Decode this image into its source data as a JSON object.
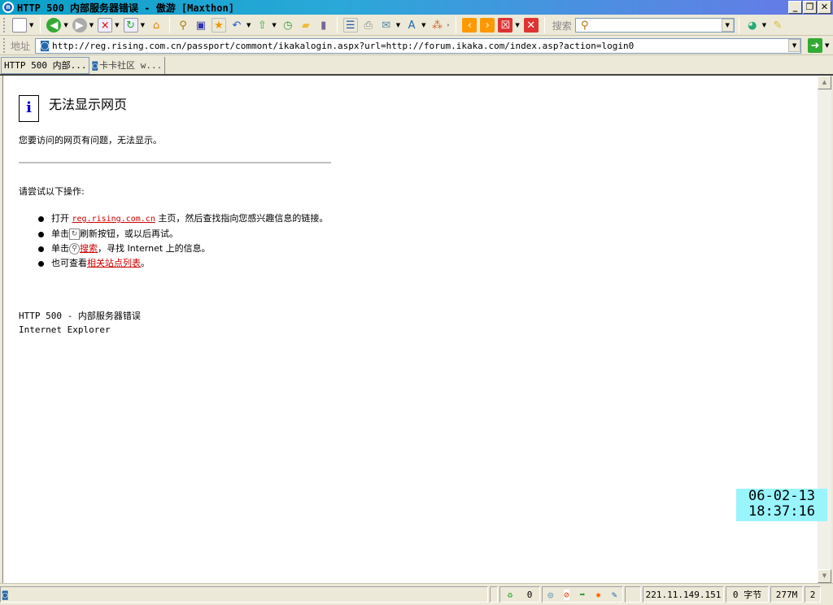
{
  "window": {
    "title": "HTTP 500 内部服务器错误 - 傲游 [Maxthon]",
    "logo": "m",
    "minimize": "_",
    "restore": "❐",
    "close": "✕"
  },
  "toolbar": {
    "search_label": "搜索",
    "search_value": ""
  },
  "address": {
    "label": "地址",
    "url": "http://reg.rising.com.cn/passport/commont/ikakalogin.aspx?url=http://forum.ikaka.com/index.asp?action=login0"
  },
  "tabs": [
    {
      "label": "HTTP 500 内部...",
      "active": true
    },
    {
      "label": "卡卡社区 w...",
      "active": false
    }
  ],
  "page": {
    "info_glyph": "i",
    "heading": "无法显示网页",
    "message": "您要访问的网页有问题，无法显示。",
    "try_label": "请尝试以下操作:",
    "items": [
      {
        "pre": "打开 ",
        "link": "reg.rising.com.cn",
        "post": " 主页，然后查找指向您感兴趣信息的链接。"
      },
      {
        "pre": "单击",
        "post": "刷新按钮，或以后再试。"
      },
      {
        "pre": "单击",
        "link": "搜索",
        "post": "，寻找 Internet 上的信息。"
      },
      {
        "pre": "也可查看",
        "link": "相关站点列表",
        "post": "。"
      }
    ],
    "error_line": "HTTP 500 - 内部服务器错误",
    "browser_line": "Internet Explorer"
  },
  "clock": {
    "date": "06-02-13",
    "time": "18:37:16"
  },
  "status": {
    "count": "0",
    "ip": "221.11.149.151",
    "bytes": "0 字节",
    "memory": "277M",
    "tabs": "2"
  }
}
